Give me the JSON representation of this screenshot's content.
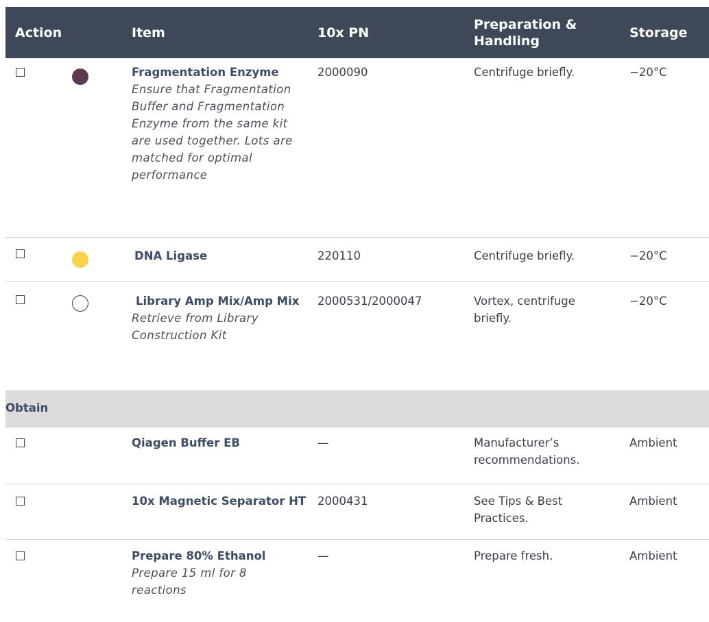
{
  "columns": {
    "action": "Action",
    "item": "Item",
    "pn": "10x PN",
    "prep_line1": "Preparation &",
    "prep_line2": "Handling",
    "storage": "Storage"
  },
  "rows": [
    {
      "name": "Fragmentation Enzyme",
      "note": "Ensure that Fragmentation Buffer and Fragmentation Enzyme from the same kit are used together. Lots are matched for optimal performance",
      "pn": "2000090",
      "prep": "Centrifuge briefly.",
      "storage": "−20°C",
      "dot_color": "#5c3a54",
      "checked": false
    },
    {
      "name": "DNA Ligase",
      "note": "",
      "pn": "220110",
      "prep": "Centrifuge briefly.",
      "storage": "−20°C",
      "dot_color": "#f7d24a",
      "checked": false
    },
    {
      "name": "Library Amp Mix/Amp Mix",
      "note": "Retrieve from Library Construction Kit",
      "pn": "2000531/2000047",
      "prep": "Vortex, centrifuge briefly.",
      "storage": "−20°C",
      "dot_color": "#ffffff",
      "checked": false
    }
  ],
  "section": {
    "label": "Obtain"
  },
  "obtain_rows": [
    {
      "name": "Qiagen Buffer EB",
      "note": "",
      "pn": "—",
      "prep": "Manufacturer’s recommendations.",
      "storage": "Ambient",
      "checked": false
    },
    {
      "name": "10x Magnetic Separator HT",
      "note": "",
      "pn": "2000431",
      "prep": "See Tips & Best Practices.",
      "storage": "Ambient",
      "checked": false
    },
    {
      "name": "Prepare 80% Ethanol",
      "note": "Prepare 15 ml for 8 reactions",
      "pn": "—",
      "prep": "Prepare fresh.",
      "storage": "Ambient",
      "checked": false
    }
  ]
}
